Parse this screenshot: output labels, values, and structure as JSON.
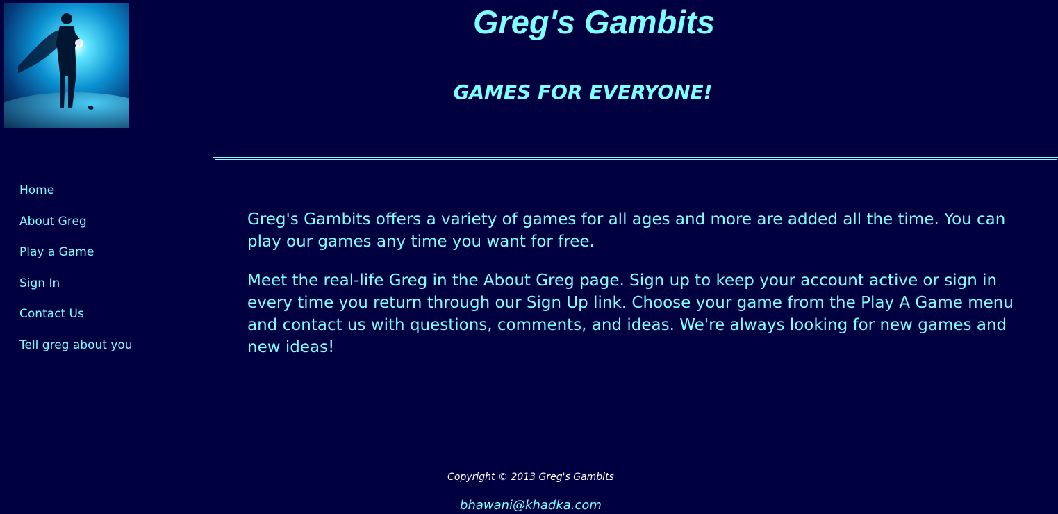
{
  "header": {
    "title": "Greg's Gambits",
    "tagline": "GAMES FOR EVERYONE!",
    "logo_icon": "superhero-silhouette-logo-icon"
  },
  "nav": {
    "items": [
      {
        "label": "Home"
      },
      {
        "label": "About Greg"
      },
      {
        "label": "Play a Game"
      },
      {
        "label": "Sign In"
      },
      {
        "label": "Contact Us"
      },
      {
        "label": "Tell greg about you"
      }
    ]
  },
  "main": {
    "paragraphs": [
      "Greg's Gambits offers a variety of games for all ages and more are added all the time. You can play our games any time you want for free.",
      "Meet the real-life Greg in the About Greg page. Sign up to keep your account active or sign in every time you return through our Sign Up link. Choose your game from the Play A Game menu and contact us with questions, comments, and ideas. We're always looking for new games and new ideas!"
    ]
  },
  "footer": {
    "copyright": "Copyright © 2013 Greg's Gambits",
    "email": "bhawani@khadka.com"
  },
  "colors": {
    "background": "#000040",
    "accent": "#7fffff",
    "footer_text": "#ffffff"
  }
}
